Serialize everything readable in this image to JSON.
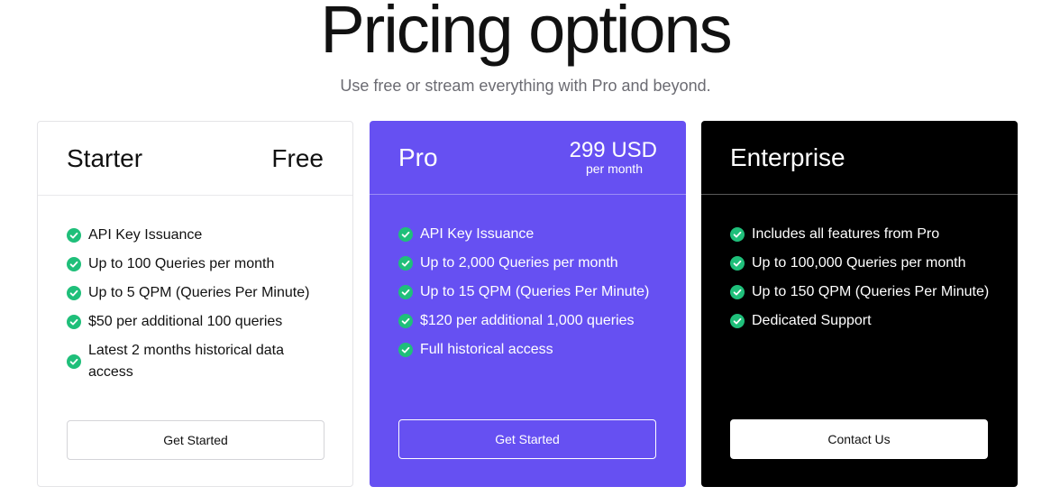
{
  "page": {
    "title": "Pricing options",
    "subtitle": "Use free or stream everything with Pro and beyond."
  },
  "colors": {
    "check": "#1fbf7a",
    "pro_background": "#6650f2",
    "enterprise_background": "#000000"
  },
  "plans": [
    {
      "name": "Starter",
      "price": "Free",
      "features": [
        "API Key Issuance",
        "Up to 100 Queries per month",
        "Up to 5 QPM (Queries Per Minute)",
        "$50 per additional 100 queries",
        "Latest 2 months historical data access"
      ],
      "cta": "Get Started"
    },
    {
      "name": "Pro",
      "price": "299 USD",
      "price_period": "per month",
      "features": [
        "API Key Issuance",
        "Up to 2,000 Queries per month",
        "Up to 15 QPM (Queries Per Minute)",
        "$120 per additional 1,000 queries",
        "Full historical access"
      ],
      "cta": "Get Started"
    },
    {
      "name": "Enterprise",
      "features": [
        "Includes all features from Pro",
        "Up to 100,000 Queries per month",
        "Up to 150 QPM (Queries Per Minute)",
        "Dedicated Support"
      ],
      "cta": "Contact Us"
    }
  ]
}
